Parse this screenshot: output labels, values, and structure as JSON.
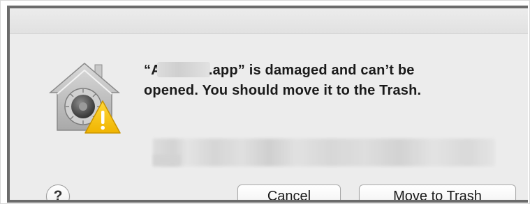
{
  "dialog": {
    "message_prefix": "“A",
    "message_suffix": ".app” is damaged and can’t be",
    "message_line2": "opened. You should move it to the Trash.",
    "icon": "gatekeeper-lock-warning-icon",
    "colors": {
      "warning_yellow": "#f5c400",
      "house_gray": "#b9b9b9",
      "lock_dark": "#4a4a4a"
    }
  },
  "buttons": {
    "help_label": "?",
    "cancel_label": "Cancel",
    "move_to_trash_label": "Move to Trash"
  }
}
